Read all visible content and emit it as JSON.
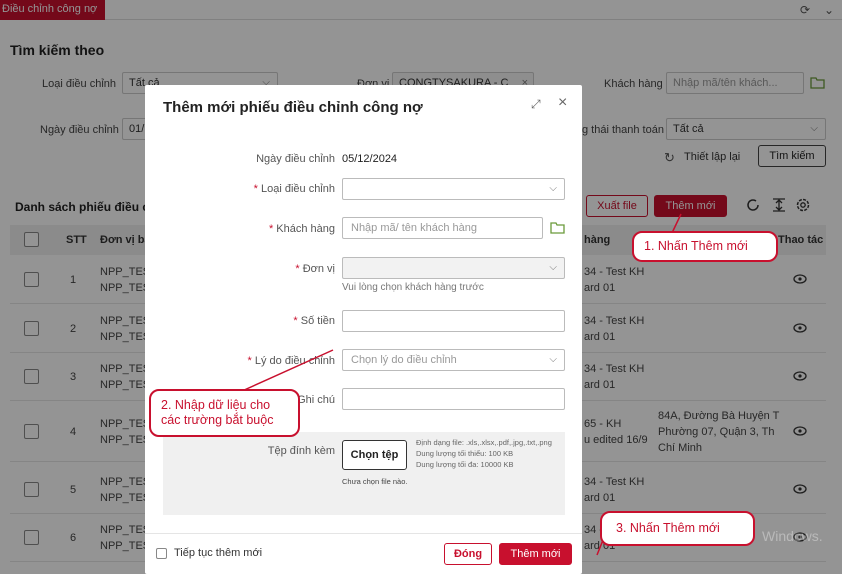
{
  "top_tab": "Điều chỉnh công nợ",
  "search": {
    "title": "Tìm kiếm theo",
    "loai_label": "Loại điều chỉnh",
    "loai_value": "Tất cả",
    "donvi_label": "Đơn vị",
    "donvi_value": "CONGTYSAKURA - C",
    "khachhang_label": "Khách hàng",
    "khachhang_placeholder": "Nhập mã/tên khách...",
    "ngay_label": "Ngày điều chỉnh",
    "ngay_value": "01/",
    "trangthai_label": "g thái thanh toán",
    "trangthai_value": "Tất cả",
    "reset_label": "Thiết lập lại",
    "search_label": "Tìm kiếm"
  },
  "list": {
    "title": "Danh sách phiếu điều ch",
    "export_label": "Xuất file",
    "add_label": "Thêm mới",
    "col_stt": "STT",
    "col_donvi": "Đơn vị bá",
    "col_hang": "hàng",
    "col_thaotac": "Thao tác",
    "rows": [
      {
        "stt": "1",
        "donvi1": "NPP_TES",
        "donvi2": "NPP_TES",
        "kh1": "34 - Test KH",
        "kh2": "ard 01",
        "addr1": "",
        "addr2": "",
        "addr3": ""
      },
      {
        "stt": "2",
        "donvi1": "NPP_TES",
        "donvi2": "NPP_TES",
        "kh1": "34 - Test KH",
        "kh2": "ard 01",
        "addr1": "",
        "addr2": "",
        "addr3": ""
      },
      {
        "stt": "3",
        "donvi1": "NPP_TES",
        "donvi2": "NPP_TES",
        "kh1": "34 - Test KH",
        "kh2": "ard 01",
        "addr1": "",
        "addr2": "",
        "addr3": ""
      },
      {
        "stt": "4",
        "donvi1": "NPP_TES",
        "donvi2": "NPP_TES",
        "kh1": "65 - KH",
        "kh2": "u edited 16/9",
        "addr1": "84A, Đường Bà Huyện T",
        "addr2": "Phường 07, Quận 3, Th",
        "addr3": "Chí Minh"
      },
      {
        "stt": "5",
        "donvi1": "NPP_TES",
        "donvi2": "NPP_TES",
        "kh1": "34 - Test KH",
        "kh2": "ard 01",
        "addr1": "",
        "addr2": "",
        "addr3": ""
      },
      {
        "stt": "6",
        "donvi1": "NPP_TES",
        "donvi2": "NPP_TES",
        "kh1": "34 - Test KH",
        "kh2": "ard 01",
        "addr1": "",
        "addr2": "",
        "addr3": ""
      }
    ]
  },
  "modal": {
    "title": "Thêm mới phiếu điều chỉnh công nợ",
    "ngay_label": "Ngày điều chỉnh",
    "ngay_value": "05/12/2024",
    "loai_label": "Loại điều chỉnh",
    "khachhang_label": "Khách hàng",
    "khachhang_placeholder": "Nhập mã/ tên khách hàng",
    "donvi_label": "Đơn vị",
    "donvi_hint": "Vui lòng chọn khách hàng trước",
    "sotien_label": "Số tiền",
    "lydo_label": "Lý do điều chỉnh",
    "lydo_placeholder": "Chọn lý do điều chỉnh",
    "ghichu_label": "Ghi chú",
    "tep_label": "Tệp đính kèm",
    "choose_file": "Chọn tệp",
    "format_note": "Định dạng file: .xls,.xlsx,.pdf,.jpg,.txt,.png",
    "min_note": "Dung lượng tối thiểu: 100 KB",
    "max_note": "Dung lượng tối đa: 10000 KB",
    "no_file": "Chưa chọn file nào.",
    "continue_label": "Tiếp tục thêm mới",
    "close_label": "Đóng",
    "submit_label": "Thêm mới"
  },
  "callouts": {
    "c1": "1. Nhấn Thêm mới",
    "c2a": "2. Nhập dữ liệu cho",
    "c2b": "các trường bắt buộc",
    "c3": "3. Nhấn Thêm mới"
  },
  "watermark": "Windows.",
  "colors": {
    "brand": "#c8102e"
  }
}
